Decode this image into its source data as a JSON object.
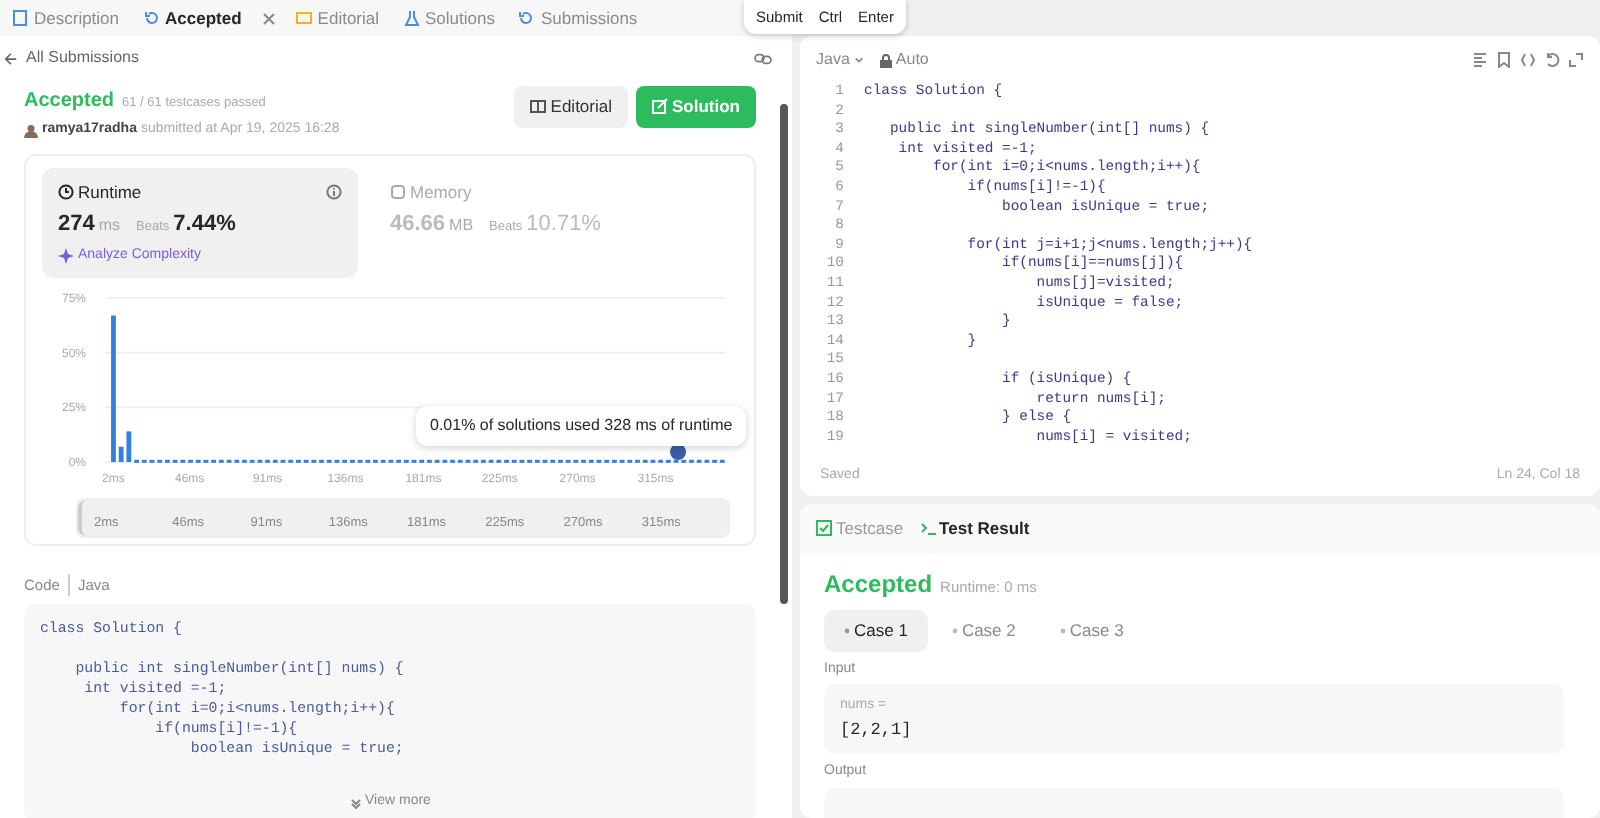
{
  "top_tabs": [
    {
      "label": "Description",
      "selected": false,
      "closable": false
    },
    {
      "label": "Accepted",
      "selected": true,
      "closable": true
    },
    {
      "label": "Editorial",
      "selected": false,
      "closable": false
    },
    {
      "label": "Solutions",
      "selected": false,
      "closable": false
    },
    {
      "label": "Submissions",
      "selected": false,
      "closable": false
    }
  ],
  "submit_hint": {
    "label": "Submit",
    "keys": [
      "Ctrl",
      "Enter"
    ]
  },
  "back_link": "All Submissions",
  "result": {
    "status": "Accepted",
    "testcases": "61 / 61 testcases passed",
    "user": "ramya17radha",
    "submitted": "submitted at Apr 19, 2025 16:28"
  },
  "actions": [
    {
      "label": "Editorial",
      "kind": "secondary"
    },
    {
      "label": "Solution",
      "kind": "primary"
    }
  ],
  "metrics": [
    {
      "label": "Runtime",
      "value": "274",
      "unit": "ms",
      "beats_label": "Beats",
      "beats": "7.44%",
      "selected": true,
      "link": "Analyze Complexity"
    },
    {
      "label": "Memory",
      "value": "46.66",
      "unit": "MB",
      "beats_label": "Beats",
      "beats": "10.71%",
      "selected": false
    }
  ],
  "chart_data": {
    "type": "bar",
    "ylim": [
      0,
      75
    ],
    "yticks": [
      {
        "value": 0,
        "label": "0%"
      },
      {
        "value": 25,
        "label": "25%"
      },
      {
        "value": 50,
        "label": "50%"
      },
      {
        "value": 75,
        "label": "75%"
      }
    ],
    "x": [
      2,
      6.45,
      10.9,
      15.35,
      19.8,
      24.25,
      28.7,
      33.15,
      37.6,
      42.05,
      46.5,
      50.95,
      55.4,
      59.85,
      64.3,
      68.75,
      73.2,
      77.65,
      82.1,
      86.55,
      91,
      95.45,
      99.9,
      104.35,
      108.8,
      113.25,
      117.7,
      122.15,
      126.6,
      131.05,
      135.5,
      139.95,
      144.4,
      148.85,
      153.3,
      157.75,
      162.2,
      166.65,
      171.1,
      175.55,
      180,
      184.45,
      188.9,
      193.35,
      197.8,
      202.25,
      206.7,
      211.15,
      215.6,
      220.05,
      224.5,
      228.95,
      233.4,
      237.85,
      242.3,
      246.75,
      251.2,
      255.65,
      260.1,
      264.55,
      269,
      273.45,
      277.9,
      282.35,
      286.8,
      291.25,
      295.7,
      300.15,
      304.6,
      309.05,
      313.5,
      317.95,
      322.4,
      326.85,
      331.3,
      335.75,
      340.2,
      344.65,
      349.1,
      353.55
    ],
    "xlim": [
      0,
      358
    ],
    "xticks": [
      {
        "value": 2,
        "label": "2ms"
      },
      {
        "value": 46,
        "label": "46ms"
      },
      {
        "value": 91,
        "label": "91ms"
      },
      {
        "value": 136,
        "label": "136ms"
      },
      {
        "value": 181,
        "label": "181ms"
      },
      {
        "value": 225,
        "label": "225ms"
      },
      {
        "value": 270,
        "label": "270ms"
      },
      {
        "value": 315,
        "label": "315ms"
      }
    ],
    "series": [
      {
        "color": "#2f80e0",
        "values": [
          67,
          7,
          14,
          1,
          1,
          1,
          1,
          1,
          1,
          1,
          1,
          1,
          1,
          1,
          1,
          1,
          1,
          1,
          1,
          1,
          1,
          1,
          1,
          1,
          1,
          1,
          1,
          1,
          1,
          1,
          1,
          1,
          1,
          1,
          1,
          1,
          1,
          1,
          1,
          1,
          1,
          1,
          1,
          1,
          1,
          1,
          1,
          1,
          1,
          1,
          1,
          1,
          1,
          1,
          1,
          1,
          1,
          1,
          1,
          1,
          1,
          1,
          1,
          1,
          1,
          1,
          1,
          1,
          1,
          1,
          1,
          1,
          1,
          1,
          1,
          1,
          1,
          1,
          1,
          1
        ]
      }
    ]
  },
  "tooltip": "0.01% of solutions used 328 ms of runtime",
  "brush": {
    "level": 1,
    "labels": [
      "2ms",
      "46ms",
      "91ms",
      "136ms",
      "181ms",
      "225ms",
      "270ms",
      "315ms"
    ]
  },
  "code_header": {
    "label": "Code",
    "language": "Java"
  },
  "code_preview": [
    {
      "kind": "code",
      "text": "class Solution {"
    },
    {
      "kind": "blank"
    },
    {
      "kind": "code",
      "text": "    public int singleNumber(int[] nums) {"
    },
    {
      "kind": "code",
      "text": "     int visited =-1;"
    },
    {
      "kind": "code",
      "text": "         for(int i=0;i<nums.length;i++){"
    },
    {
      "kind": "code",
      "text": "             if(nums[i]!=-1){"
    },
    {
      "kind": "code",
      "text": "                 boolean isUnique = true;"
    }
  ],
  "view_more": "View more",
  "editor": {
    "language": "Java",
    "mode": "Auto",
    "lines": [
      {
        "num": "1",
        "text": "class Solution {"
      },
      {
        "num": "2"
      },
      {
        "num": "3",
        "text": "   public int singleNumber(int[] nums) {"
      },
      {
        "num": "4",
        "text": "    int visited =-1;"
      },
      {
        "num": "5",
        "text": "        for(int i=0;i<nums.length;i++){"
      },
      {
        "num": "6",
        "text": "            if(nums[i]!=-1){"
      },
      {
        "num": "7",
        "text": "                boolean isUnique = true;"
      },
      {
        "num": "8"
      },
      {
        "num": "9",
        "text": "            for(int j=i+1;j<nums.length;j++){"
      },
      {
        "num": "10",
        "text": "                if(nums[i]==nums[j]){"
      },
      {
        "num": "11",
        "text": "                    nums[j]=visited;"
      },
      {
        "num": "12",
        "text": "                    isUnique = false;"
      },
      {
        "num": "13",
        "text": "                }"
      },
      {
        "num": "14",
        "text": "            }"
      },
      {
        "num": "15"
      },
      {
        "num": "16",
        "text": "                if (isUnique) {"
      },
      {
        "num": "17",
        "text": "                    return nums[i];"
      },
      {
        "num": "18",
        "text": "                } else {"
      },
      {
        "num": "19",
        "text": "                    nums[i] = visited;"
      }
    ],
    "status": "Saved",
    "position": "Ln 24, Col 18"
  },
  "test_panel": {
    "tabs": [
      {
        "label": "Testcase",
        "selected": false
      },
      {
        "label": "Test Result",
        "selected": true
      }
    ],
    "status": "Accepted",
    "runtime": "Runtime: 0 ms",
    "cases": [
      {
        "label": "Case 1",
        "selected": true
      },
      {
        "label": "Case 2",
        "selected": false
      },
      {
        "label": "Case 3",
        "selected": false
      }
    ],
    "input_label": "Input",
    "param": "nums =",
    "input_value": "[2,2,1]",
    "output_label": "Output"
  }
}
